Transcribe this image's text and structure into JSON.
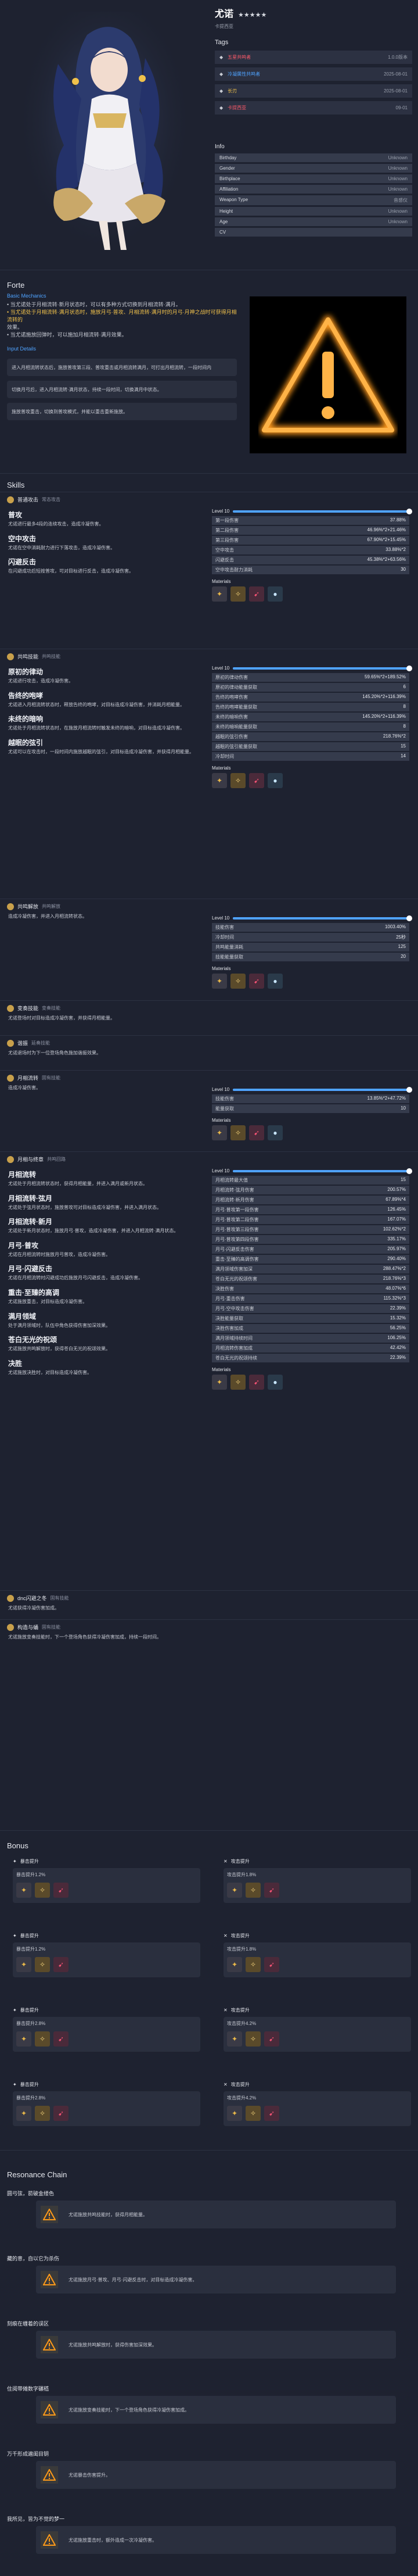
{
  "header": {
    "name": "尤诺",
    "stars": "★★★★★",
    "subtitle": "卡提西亚",
    "tags_title": "Tags",
    "tags": [
      {
        "label": "五星共鸣者",
        "value": "1.0.0版本",
        "color": "#ff5a6a"
      },
      {
        "label": "冷凝属性共鸣者",
        "value": "2025-08-01",
        "color": "#4fa3ff"
      },
      {
        "label": "长刃",
        "value": "2025-08-01",
        "color": "#f0c14b"
      },
      {
        "label": "卡提西亚",
        "value": "09-01",
        "color": "#ff5a6a"
      }
    ],
    "info_title": "Info",
    "info": [
      {
        "k": "Birthday",
        "v": "Unknown"
      },
      {
        "k": "Gender",
        "v": "Unknown"
      },
      {
        "k": "Birthplace",
        "v": "Unknown"
      },
      {
        "k": "Affiliation",
        "v": "Unknown"
      },
      {
        "k": "Weapon Type",
        "v": "音感仪"
      },
      {
        "k": "Height",
        "v": "Unknown"
      },
      {
        "k": "Age",
        "v": "Unknown"
      },
      {
        "k": "CV",
        "v": ""
      }
    ]
  },
  "forte": {
    "title": "Forte",
    "basic_title": "Basic Mechanics",
    "basic_lines": [
      "• 当尤诺处于月相流转·新月状态时，可以有多种方式切换到月相流转·满月。",
      "• 当尤诺处于月相流转·满月状态时，施放月弓·普攻、月相流转·满月时的月弓·月神之战时可获得月相流转的",
      "  效果。",
      "• 当尤诺施放回弹时，可以施加月相流转·满月效果。"
    ],
    "input_title": "Input Details",
    "inputs": [
      "进入月相流转状态后，施放普攻第三段、普攻重击或月相流转满月，可打出月相流转，一段时间内",
      "切换月弓后，进入月相流转·满月状态，持续一段时间，切换满月中状态。",
      "施放普攻重击，切换到普攻模式，并能以重击重新施放。"
    ]
  },
  "skills": {
    "title": "Skills",
    "materials_label": "Materials",
    "level_label": "Level 10",
    "blocks": [
      {
        "header": "普通攻击",
        "tag": "常态攻击",
        "moves": [
          {
            "name": "普攻",
            "desc": "尤诺进行最多4段的连续攻击，造成冷凝伤害。"
          },
          {
            "name": "空中攻击",
            "desc": "尤诺在空中消耗耐力进行下落攻击，造成冷凝伤害。"
          },
          {
            "name": "闪避反击",
            "desc": "在闪避成功后短按普攻，可对目标进行反击，造成冷凝伤害。"
          }
        ],
        "stats": [
          [
            "第一段伤害",
            "37.88%"
          ],
          [
            "第二段伤害",
            "46.96%*2+21.46%"
          ],
          [
            "第三段伤害",
            "67.90%*2+15.45%"
          ],
          [
            "空中攻击",
            "33.88%*2"
          ],
          [
            "闪避反击",
            "45.38%*2+63.56%"
          ],
          [
            "空中攻击耐力消耗",
            "30"
          ]
        ],
        "level_pct": 100
      },
      {
        "header": "共鸣技能",
        "tag": "共鸣技能",
        "moves": [
          {
            "name": "原初的律动",
            "desc": "尤诺进行攻击，造成冷凝伤害。"
          },
          {
            "name": "告终的咆哮",
            "desc": "尤诺进入月相流转状态时，释放告终的咆哮，对目标造成冷凝伤害，并消耗月相能量。"
          },
          {
            "name": "未终的暗响",
            "desc": "尤诺处于月相流转状态时，在施放月相流转时触发未终的暗响，对目标造成冷凝伤害。"
          },
          {
            "name": "越眠的弦引",
            "desc": "尤诺可以在攻击时，一段时间内施放越眠的弦引，对目标造成冷凝伤害，并获得月相能量。"
          }
        ],
        "stats": [
          [
            "原初的律动伤害",
            "59.65%*2+189.52%"
          ],
          [
            "原初的律动能量获取",
            "6"
          ],
          [
            "告终的咆哮伤害",
            "145.20%*2+116.39%"
          ],
          [
            "告终的咆哮能量获取",
            "8"
          ],
          [
            "未终的暗响伤害",
            "145.20%*2+116.39%"
          ],
          [
            "未终的暗响能量获取",
            "8"
          ],
          [
            "越眠的弦引伤害",
            "218.76%*2"
          ],
          [
            "越眠的弦引能量获取",
            "15"
          ],
          [
            "冷却时间",
            "14"
          ]
        ],
        "level_pct": 100
      },
      {
        "header": "共鸣解放",
        "tag": "共鸣解放",
        "moves": [
          {
            "name": "",
            "desc": "造成冷凝伤害，并进入月相流转状态。"
          }
        ],
        "stats": [
          [
            "技能伤害",
            "1003.40%"
          ],
          [
            "冷却时间",
            "25秒"
          ],
          [
            "共鸣能量消耗",
            "125"
          ],
          [
            "技能能量获取",
            "20"
          ]
        ],
        "level_pct": 100
      },
      {
        "header": "变奏技能",
        "tag": "变奏技能",
        "moves": [
          {
            "name": "",
            "desc": "尤诺登场时对目标造成冷凝伤害，并获得月相能量。"
          }
        ],
        "stats": [],
        "level_pct": 0
      },
      {
        "header": "谐振",
        "tag": "延奏技能",
        "moves": [
          {
            "name": "",
            "desc": "尤诺退场时为下一位登场角色施加谐振效果。"
          }
        ],
        "stats": [],
        "level_pct": 0
      },
      {
        "header": "月相流转",
        "tag": "固有技能",
        "moves": [
          {
            "name": "",
            "desc": "造成冷凝伤害。"
          }
        ],
        "stats": [
          [
            "技能伤害",
            "13.85%*2+47.72%"
          ],
          [
            "能量获取",
            "10"
          ]
        ],
        "level_pct": 100
      },
      {
        "header": "月相与终章",
        "tag": "共鸣回路",
        "moves": [
          {
            "name": "月相流转",
            "desc": "尤诺处于月相流转状态时，获得月相能量，并进入满月或新月状态。"
          },
          {
            "name": "月相流转·弦月",
            "desc": "尤诺处于弦月状态时，施放普攻可对目标造成冷凝伤害，并进入满月状态。"
          },
          {
            "name": "月相流转·新月",
            "desc": "尤诺处于新月状态时，施放月弓·普攻，造成冷凝伤害，并进入月相流转·满月状态。"
          },
          {
            "name": "月弓·普攻",
            "desc": "尤诺在月相流转时施放月弓普攻，造成冷凝伤害。"
          },
          {
            "name": "月弓·闪避反击",
            "desc": "尤诺在月相流转时闪避成功后施放月弓闪避反击，造成冷凝伤害。"
          },
          {
            "name": "重击·至臻的高调",
            "desc": "尤诺施放重击，对目标造成冷凝伤害。"
          },
          {
            "name": "满月领域",
            "desc": "处于满月领域时，队伍中角色获得伤害加深效果。"
          },
          {
            "name": "苍白无光的祝颂",
            "desc": "尤诺施放共鸣解放时，获得苍白无光的祝颂效果。"
          },
          {
            "name": "决胜",
            "desc": "尤诺施放决胜时，对目标造成冷凝伤害。"
          }
        ],
        "stats": [
          [
            "月相流转最大值",
            "15"
          ],
          [
            "月相流转·弦月伤害",
            "200.57%"
          ],
          [
            "月相流转·新月伤害",
            "67.89%*4"
          ],
          [
            "月弓·普攻第一段伤害",
            "126.45%"
          ],
          [
            "月弓·普攻第二段伤害",
            "167.07%"
          ],
          [
            "月弓·普攻第三段伤害",
            "102.62%*2"
          ],
          [
            "月弓·普攻第四段伤害",
            "335.17%"
          ],
          [
            "月弓·闪避反击伤害",
            "205.97%"
          ],
          [
            "重击·至臻的高调伤害",
            "290.40%"
          ],
          [
            "满月领域伤害加深",
            "288.47%*2"
          ],
          [
            "苍白无光的祝颂伤害",
            "218.76%*3"
          ],
          [
            "决胜伤害",
            "48.07%*6"
          ],
          [
            "月弓·重击伤害",
            "115.32%*3"
          ],
          [
            "月弓·空中攻击伤害",
            "22.39%"
          ],
          [
            "决胜能量获取",
            "15.32%"
          ],
          [
            "决胜伤害加成",
            "56.25%"
          ],
          [
            "满月领域持续时间",
            "106.25%"
          ],
          [
            "月相流转伤害加成",
            "42.42%"
          ],
          [
            "苍白无光的祝颂持续",
            "22.39%"
          ]
        ],
        "level_pct": 100
      },
      {
        "header": "dnc闪避之冬",
        "tag": "固有技能",
        "moves": [
          {
            "name": "",
            "desc": "尤诺获得冷凝伤害加成。"
          }
        ],
        "stats": [],
        "level_pct": 0
      },
      {
        "header": "构造与蛹",
        "tag": "固有技能",
        "moves": [
          {
            "name": "",
            "desc": "尤诺施放变奏技能时，下一个登场角色获得冷凝伤害加成，持续一段时间。"
          }
        ],
        "stats": [],
        "level_pct": 0
      }
    ]
  },
  "bonus": {
    "title": "Bonus",
    "items": [
      {
        "name": "暴击提升",
        "value": "暴击提升1.2%"
      },
      {
        "name": "攻击提升",
        "value": "攻击提升1.8%"
      },
      {
        "name": "暴击提升",
        "value": "暴击提升1.2%"
      },
      {
        "name": "攻击提升",
        "value": "攻击提升1.8%"
      },
      {
        "name": "暴击提升",
        "value": "暴击提升2.8%"
      },
      {
        "name": "攻击提升",
        "value": "攻击提升4.2%"
      },
      {
        "name": "暴击提升",
        "value": "暴击提升2.8%"
      },
      {
        "name": "攻击提升",
        "value": "攻击提升4.2%"
      }
    ]
  },
  "chain": {
    "title": "Resonance Chain",
    "items": [
      {
        "name": "圆弓弦，箭破金缕色",
        "desc": "尤诺施放共鸣技能时，获得月相能量。"
      },
      {
        "name": "藏的意，自以它为杀伤",
        "desc": "尤诺施放月弓·普攻、月弓·闪避反击时，对目标造成冷凝伤害。"
      },
      {
        "name": "刻痕在缠着的误区",
        "desc": "尤诺施放共鸣解放时，获得伤害加深效果。"
      },
      {
        "name": "住阅带傩数字碾嵇",
        "desc": "尤诺施放变奏技能时，下一个登场角色获得冷凝伤害加成。"
      },
      {
        "name": "万千形成遍闺目钥",
        "desc": "尤诺暴击伤害提升。"
      },
      {
        "name": "我所见，皆为不觉的梦一",
        "desc": "尤诺施放重击时，额外造成一次冷凝伤害。"
      }
    ]
  },
  "colors": {
    "bg": "#1e2230",
    "accent": "#4fa3ff",
    "gold": "#f0c14b"
  }
}
